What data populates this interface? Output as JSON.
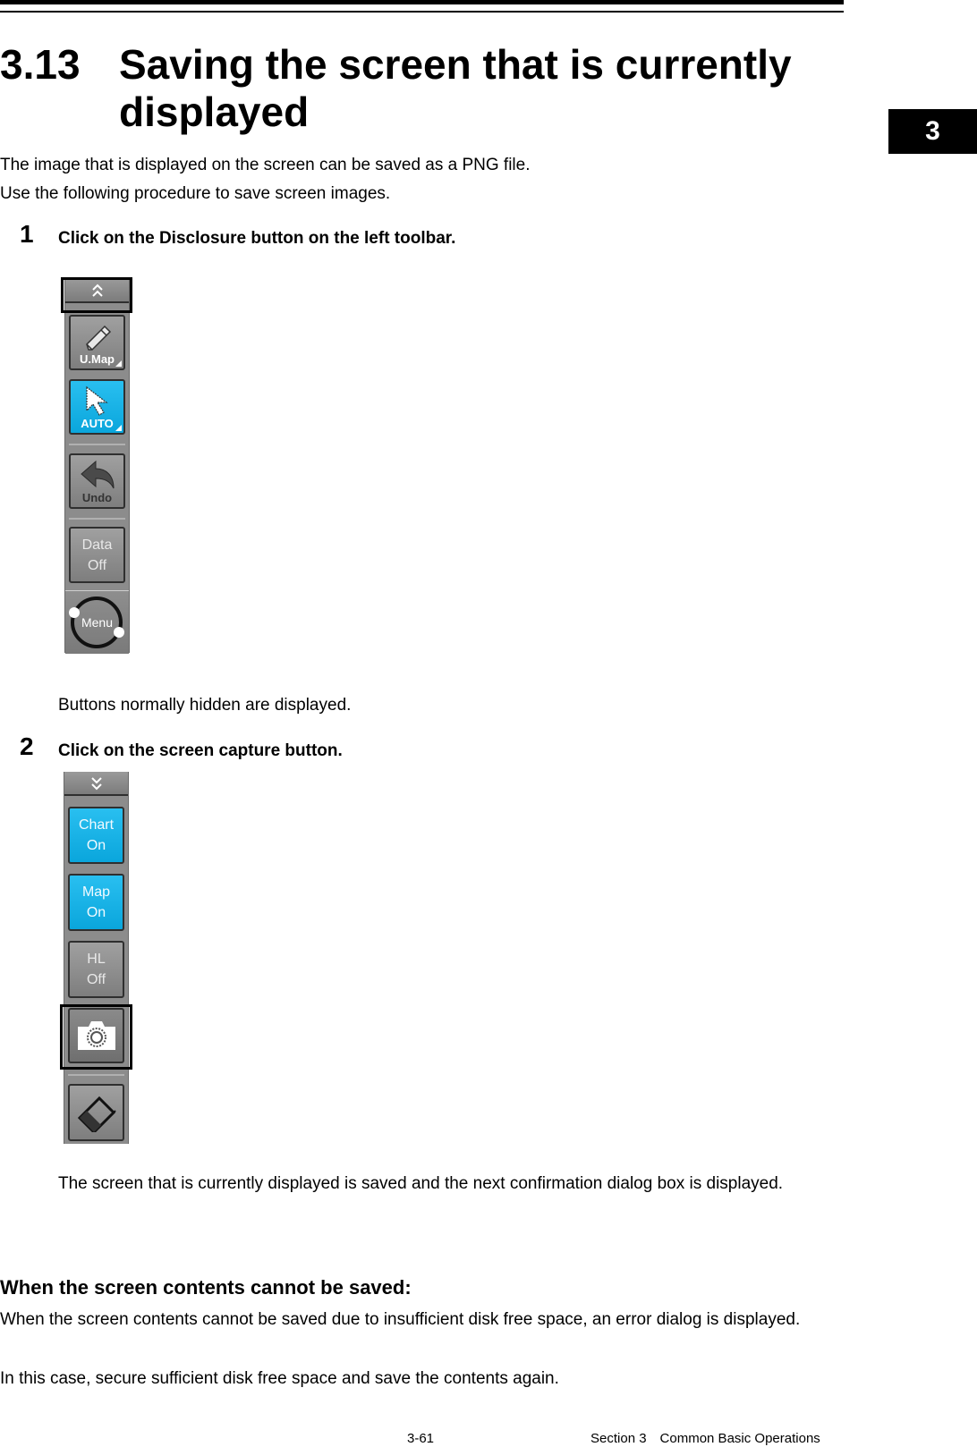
{
  "page": {
    "chapter_tab": "3",
    "section_number": "3.13",
    "section_title": "Saving the screen that is currently displayed",
    "intro": [
      "The image that is displayed on the screen can be saved as a PNG file.",
      "Use the following procedure to save screen images."
    ],
    "steps": [
      {
        "number": "1",
        "instruction": "Click on the Disclosure button on the left toolbar.",
        "result": "Buttons normally hidden are displayed."
      },
      {
        "number": "2",
        "instruction": "Click on the screen capture button.",
        "result": "The screen that is currently displayed is saved and the next confirmation dialog box is displayed."
      }
    ],
    "note": {
      "heading": "When the screen contents cannot be saved:",
      "body": [
        "When the screen contents cannot be saved due to insufficient disk free space, an error dialog is displayed.",
        "In this case, secure sufficient disk free space and save the contents again."
      ]
    },
    "footer": {
      "page_number": "3-61",
      "section": "Section 3 Common Basic Operations"
    }
  },
  "toolbar1": {
    "disclosure_icon": "double-chevron-up-icon",
    "buttons": [
      {
        "label": "U.Map",
        "icon": "pencil-icon",
        "active": false
      },
      {
        "label": "AUTO",
        "icon": "cursor-arrow-icon",
        "active": true
      },
      {
        "label": "Undo",
        "icon": "undo-arrow-icon",
        "active": false
      },
      {
        "label_line1": "Data",
        "label_line2": "Off",
        "active": false
      }
    ],
    "menu_label": "Menu",
    "colors": {
      "active": "#1eb6e8",
      "inactive": "#8c8c8c"
    }
  },
  "toolbar2": {
    "collapse_icon": "double-chevron-down-icon",
    "buttons": [
      {
        "label_line1": "Chart",
        "label_line2": "On",
        "active": true
      },
      {
        "label_line1": "Map",
        "label_line2": "On",
        "active": true
      },
      {
        "label_line1": "HL",
        "label_line2": "Off",
        "active": false
      },
      {
        "icon": "camera-icon",
        "highlighted": true
      },
      {
        "icon": "eraser-icon"
      }
    ]
  }
}
